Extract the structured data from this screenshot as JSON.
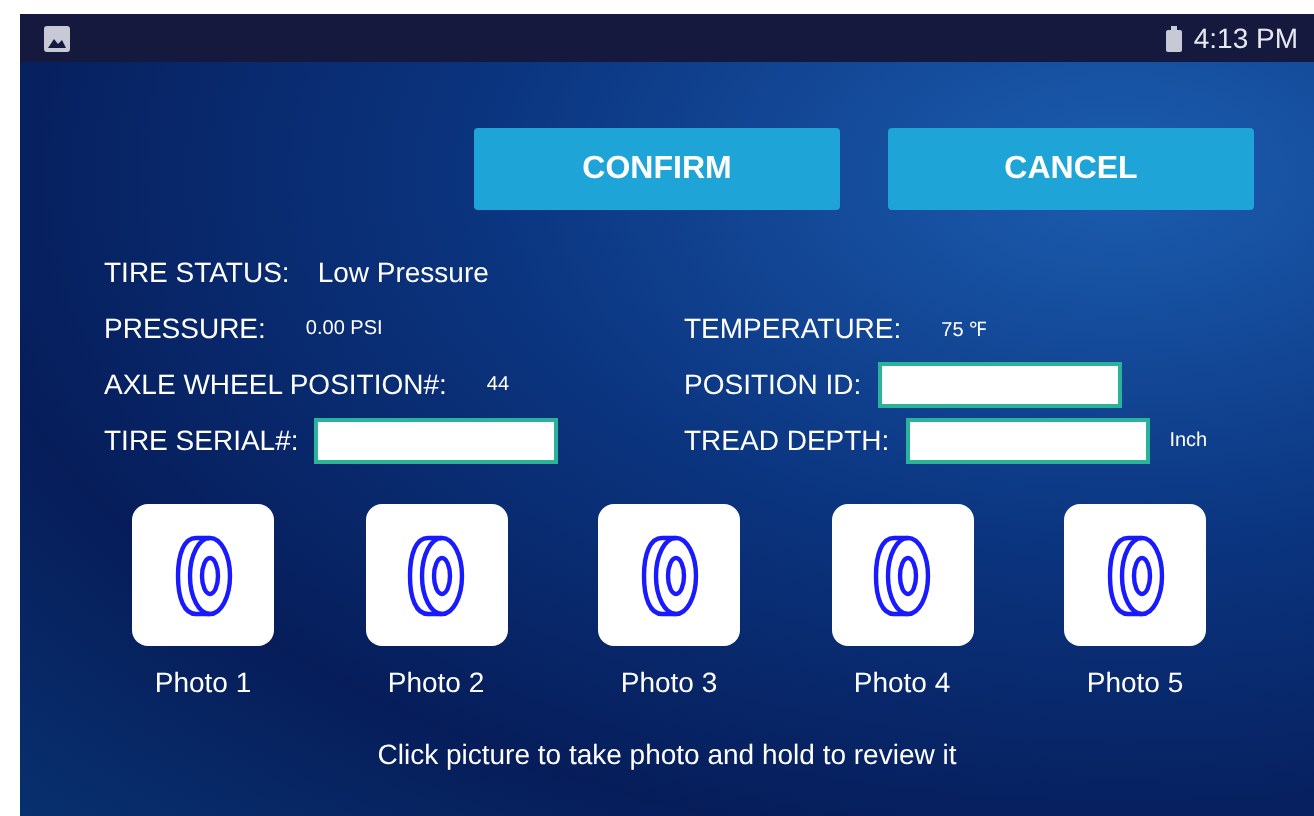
{
  "status_bar": {
    "time": "4:13 PM"
  },
  "buttons": [
    {
      "label": "CONFIRM"
    },
    {
      "label": "CANCEL"
    }
  ],
  "tire_status": {
    "label": "TIRE STATUS:",
    "value": "Low Pressure"
  },
  "pressure": {
    "label": "PRESSURE:",
    "value": "0.00 PSI"
  },
  "temperature": {
    "label": "TEMPERATURE:",
    "value": "75 ℉"
  },
  "axle_wheel_position": {
    "label": "AXLE WHEEL POSITION#:",
    "value": "44"
  },
  "position_id": {
    "label": "POSITION ID:"
  },
  "tire_serial": {
    "label": "TIRE SERIAL#:"
  },
  "tread_depth": {
    "label": "TREAD DEPTH:",
    "unit": "Inch"
  },
  "photos": [
    {
      "label": "Photo 1"
    },
    {
      "label": "Photo 2"
    },
    {
      "label": "Photo 3"
    },
    {
      "label": "Photo 4"
    },
    {
      "label": "Photo 5"
    }
  ],
  "hint": "Click picture to take photo and hold to review it"
}
